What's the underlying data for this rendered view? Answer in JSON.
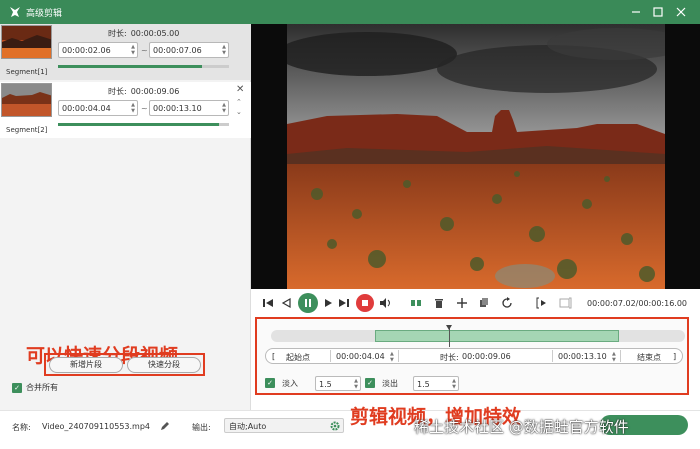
{
  "window": {
    "title": "高级剪辑"
  },
  "segments": [
    {
      "label": "Segment[1]",
      "duration_label": "时长:",
      "duration": "00:00:05.00",
      "start": "00:00:02.06",
      "end": "00:00:07.06",
      "tilde": "~",
      "progress": 0.84
    },
    {
      "label": "Segment[2]",
      "duration_label": "时长:",
      "duration": "00:00:09.06",
      "start": "00:00:04.04",
      "end": "00:00:13.10",
      "tilde": "~",
      "progress": 0.94
    }
  ],
  "left_buttons": {
    "new_segment": "新增片段",
    "quick_split": "快速分段"
  },
  "merge_all": {
    "label": "合并所有",
    "checked": true
  },
  "caption_left": "可以快速分段视频",
  "player": {
    "timecode": "00:00:07.02/00:00:16.00"
  },
  "editor": {
    "start_label": "起始点",
    "start_value": "00:00:04.04",
    "duration_label": "时长:",
    "duration_value": "00:00:09.06",
    "end_value": "00:00:13.10",
    "end_label": "结束点",
    "bracket_open": "[",
    "bracket_close": "]",
    "fade_in_label": "淡入",
    "fade_in_value": "1.5",
    "fade_out_label": "淡出",
    "fade_out_value": "1.5",
    "selection_start": 0.25,
    "selection_end": 0.84,
    "playhead": 0.43
  },
  "caption_right": "剪辑视频，增加特效",
  "footer": {
    "name_label": "名称:",
    "file_name": "Video_240709110553.mp4",
    "output_label": "输出:",
    "output_value": "自动;Auto"
  },
  "watermark": "稀土技术社区 @数据蛙官方软件",
  "colors": {
    "accent": "#3d8f5c",
    "titlebar": "#3a8a58",
    "highlight": "#e03c20"
  }
}
